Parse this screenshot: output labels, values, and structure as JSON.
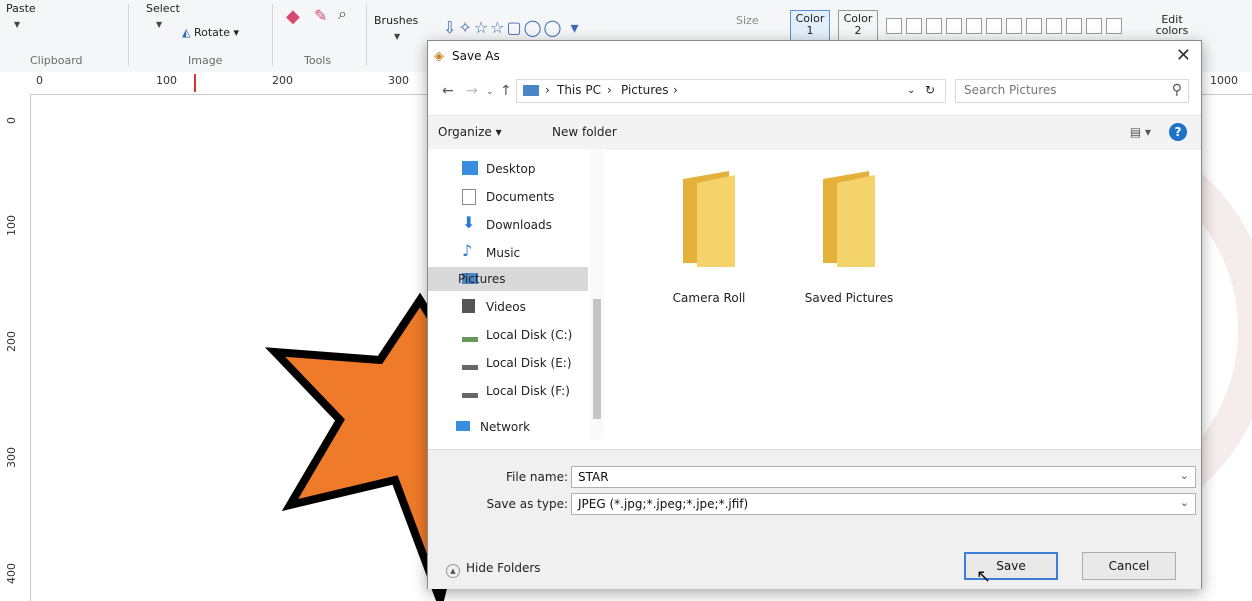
{
  "ribbon": {
    "paste": "Paste",
    "select": "Select",
    "rotate": "Rotate",
    "brushes": "Brushes",
    "size": "Size",
    "color1": "Color",
    "color1_num": "1",
    "color2": "Color",
    "color2_num": "2",
    "edit_colors": "Edit colors",
    "groups": {
      "clipboard": "Clipboard",
      "image": "Image",
      "tools": "Tools"
    }
  },
  "ruler": {
    "h": [
      "0",
      "100",
      "200",
      "300",
      "1000"
    ],
    "v": [
      "0",
      "100",
      "200",
      "300",
      "400"
    ]
  },
  "dialog": {
    "title": "Save As",
    "close": "✕",
    "breadcrumb": [
      "This PC",
      "Pictures"
    ],
    "search_placeholder": "Search Pictures",
    "toolbar": {
      "organize": "Organize ▾",
      "new_folder": "New folder"
    },
    "nav_items": [
      {
        "label": "Desktop",
        "icon": "desktop-icon"
      },
      {
        "label": "Documents",
        "icon": "documents-icon"
      },
      {
        "label": "Downloads",
        "icon": "downloads-icon"
      },
      {
        "label": "Music",
        "icon": "music-icon"
      },
      {
        "label": "Pictures",
        "icon": "pictures-icon"
      },
      {
        "label": "Videos",
        "icon": "videos-icon"
      },
      {
        "label": "Local Disk (C:)",
        "icon": "disk-icon"
      },
      {
        "label": "Local Disk (E:)",
        "icon": "disk-icon"
      },
      {
        "label": "Local Disk (F:)",
        "icon": "disk-icon"
      },
      {
        "label": "Network",
        "icon": "network-icon"
      }
    ],
    "selected_nav": "Pictures",
    "folders": [
      "Camera Roll",
      "Saved Pictures"
    ],
    "file_name_label": "File name:",
    "file_name": "STAR",
    "save_type_label": "Save as type:",
    "save_type": "JPEG (*.jpg;*.jpeg;*.jpe;*.jfif)",
    "hide_folders": "Hide Folders",
    "save": "Save",
    "cancel": "Cancel"
  },
  "colors": {
    "star_fill": "#ee7a2a",
    "accent": "#1e73c8",
    "folder": "#f2c447"
  }
}
